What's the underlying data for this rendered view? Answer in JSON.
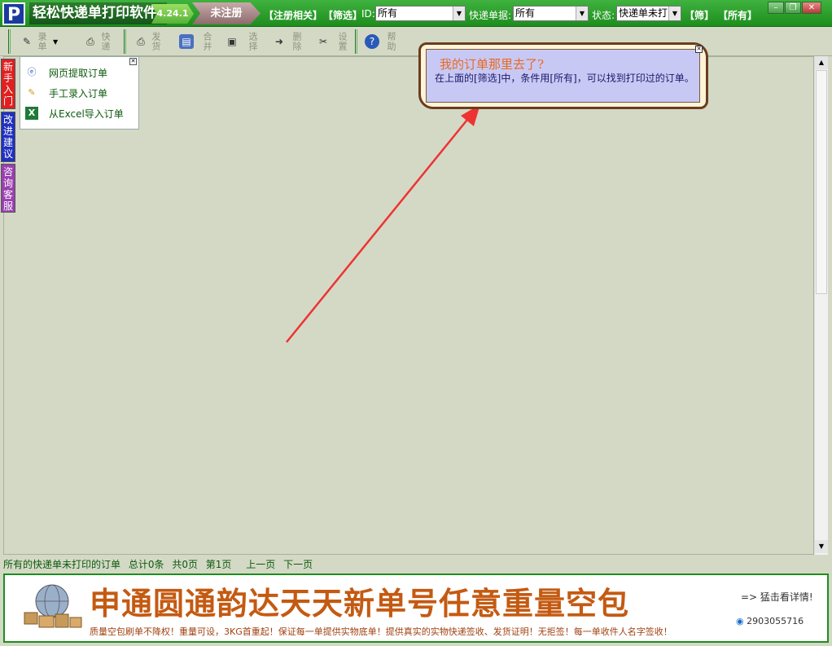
{
  "titlebar": {
    "logo": "P",
    "app_title": "轻松快递单打印软件",
    "version": "4.24.1",
    "reg_badge": "未注册",
    "link_register": "【注册相关】",
    "link_filter": "【筛选】",
    "id_label": "ID:",
    "id_value": "所有",
    "express_label": "快递单据:",
    "express_value": "所有",
    "status_label": "状态:",
    "status_value": "快递单未打",
    "btn_filter": "【筛】",
    "btn_all": "【所有】"
  },
  "toolbar": {
    "items": [
      {
        "label": "录单",
        "icon": "add-order-icon"
      },
      {
        "label": "快递",
        "icon": "print-icon"
      },
      {
        "label": "发货",
        "icon": "printer-icon"
      },
      {
        "label": "合并",
        "icon": "merge-icon"
      },
      {
        "label": "选择",
        "icon": "select-icon"
      },
      {
        "label": "删除",
        "icon": "delete-icon"
      },
      {
        "label": "设置",
        "icon": "settings-icon"
      },
      {
        "label": "帮助",
        "icon": "help-icon"
      }
    ]
  },
  "sidetabs": {
    "newbie": "新手入门",
    "suggest": "改进建议",
    "service": "咨询客服"
  },
  "menu": {
    "items": [
      {
        "label": "网页提取订单",
        "icon": "web-icon"
      },
      {
        "label": "手工录入订单",
        "icon": "edit-icon"
      },
      {
        "label": "从Excel导入订单",
        "icon": "excel-icon"
      }
    ]
  },
  "bubble": {
    "title": "我的订单那里去了?",
    "text": "在上面的[筛选]中，条件用[所有]，可以找到打印过的订单。"
  },
  "statusbar": {
    "desc": "所有的快递单未打印的订单",
    "total": "总计0条",
    "pages": "共0页",
    "current": "第1页",
    "prev": "上一页",
    "next": "下一页"
  },
  "banner": {
    "headline": "申通圆通韵达天天新单号任意重量空包",
    "sub": "质量空包刷单不降权！重量可设，3KG首重起！保证每一单提供实物底单！提供真实的实物快递签收、发货证明！无拒签！每一单收件人名字签收！",
    "more": "=> 猛击看详情!",
    "qq": "2903055716"
  },
  "colors": {
    "brand_green": "#1d8e1d",
    "banner_orange": "#c45a12",
    "newbie_tab": "#e02020",
    "suggest_tab": "#2030c0",
    "service_tab": "#9a3fb0",
    "arrow": "#ee3333"
  }
}
